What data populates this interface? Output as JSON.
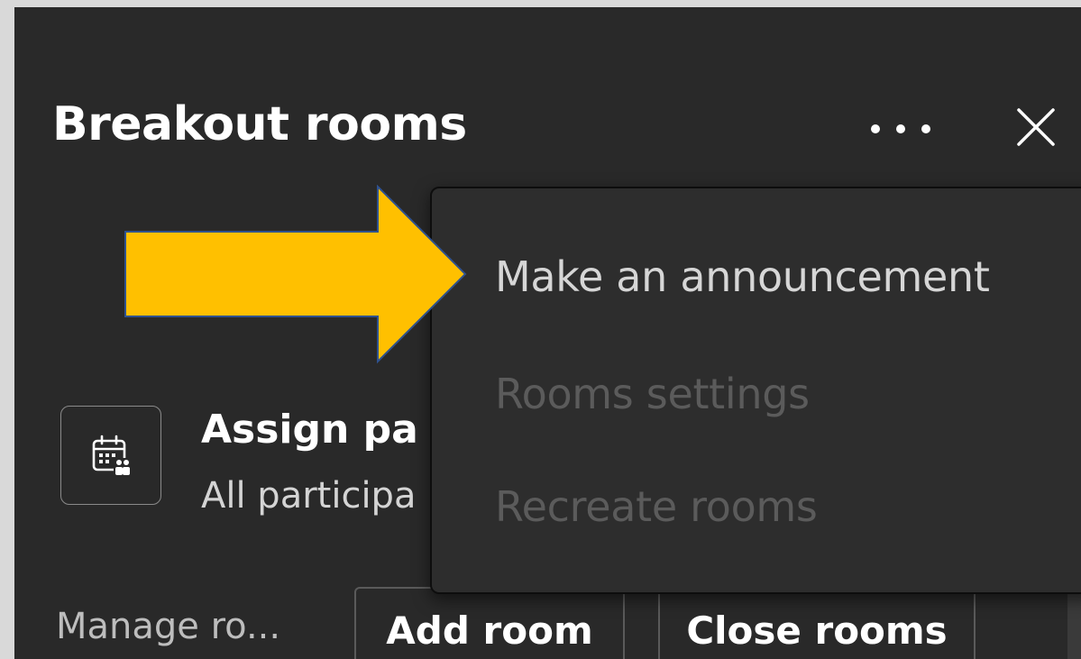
{
  "panel": {
    "title": "Breakout rooms",
    "more_icon": "more-horizontal-icon",
    "close_icon": "close-icon"
  },
  "assign": {
    "icon": "calendar-people-icon",
    "title": "Assign pa",
    "subtitle": "All participa"
  },
  "footer": {
    "manage_label": "Manage ro...",
    "add_room_label": "Add room",
    "close_rooms_label": "Close rooms"
  },
  "menu": {
    "items": [
      {
        "label": "Make an announcement",
        "enabled": true
      },
      {
        "label": "Rooms settings",
        "enabled": false
      },
      {
        "label": "Recreate rooms",
        "enabled": false
      }
    ]
  },
  "annotation": {
    "arrow_icon": "arrow-right-icon",
    "arrow_color": "#FFC000",
    "arrow_outline": "#2F528F"
  },
  "colors": {
    "panel_bg": "#292929",
    "menu_bg": "#2d2d2d",
    "text_primary": "#ffffff",
    "text_disabled": "#5b5b5b"
  }
}
